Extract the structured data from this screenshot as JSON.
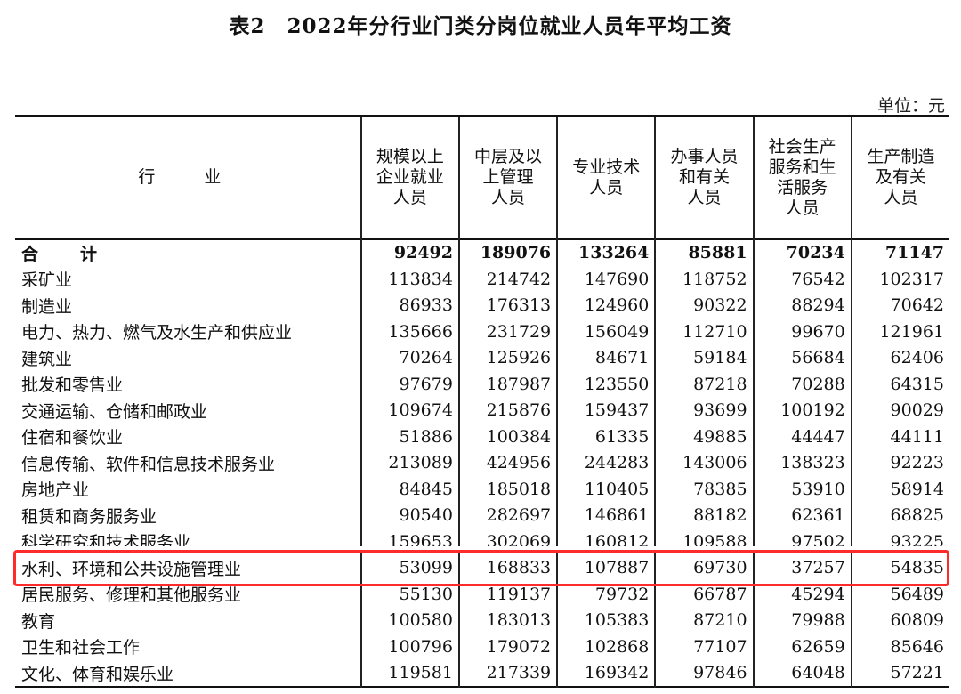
{
  "title": "表2　2022年分行业门类分岗位就业人员年平均工资",
  "unit": "单位：元",
  "headers": {
    "industry": "行　业",
    "cols": [
      [
        "规模以上",
        "企业就业",
        "人员"
      ],
      [
        "中层及以",
        "上管理",
        "人员"
      ],
      [
        "专业技术",
        "人员"
      ],
      [
        "办事人员",
        "和有关",
        "人员"
      ],
      [
        "社会生产",
        "服务和生",
        "活服务",
        "人员"
      ],
      [
        "生产制造",
        "及有关",
        "人员"
      ]
    ]
  },
  "rows": [
    {
      "name": "合　计",
      "values": [
        "92492",
        "189076",
        "133264",
        "85881",
        "70234",
        "71147"
      ],
      "total": true
    },
    {
      "name": "采矿业",
      "values": [
        "113834",
        "214742",
        "147690",
        "118752",
        "76542",
        "102317"
      ]
    },
    {
      "name": "制造业",
      "values": [
        "86933",
        "176313",
        "124960",
        "90322",
        "88294",
        "70642"
      ]
    },
    {
      "name": "电力、热力、燃气及水生产和供应业",
      "values": [
        "135666",
        "231729",
        "156049",
        "112710",
        "99670",
        "121961"
      ]
    },
    {
      "name": "建筑业",
      "values": [
        "70264",
        "125926",
        "84671",
        "59184",
        "56684",
        "62406"
      ]
    },
    {
      "name": "批发和零售业",
      "values": [
        "97679",
        "187987",
        "123550",
        "87218",
        "70288",
        "64315"
      ]
    },
    {
      "name": "交通运输、仓储和邮政业",
      "values": [
        "109674",
        "215876",
        "159437",
        "93699",
        "100192",
        "90029"
      ]
    },
    {
      "name": "住宿和餐饮业",
      "values": [
        "51886",
        "100384",
        "61335",
        "49885",
        "44447",
        "44111"
      ]
    },
    {
      "name": "信息传输、软件和信息技术服务业",
      "values": [
        "213089",
        "424956",
        "244283",
        "143006",
        "138323",
        "92223"
      ]
    },
    {
      "name": "房地产业",
      "values": [
        "84845",
        "185018",
        "110405",
        "78385",
        "53910",
        "58914"
      ]
    },
    {
      "name": "租赁和商务服务业",
      "values": [
        "90540",
        "282697",
        "146861",
        "88182",
        "62361",
        "68825"
      ]
    },
    {
      "name": "科学研究和技术服务业",
      "values": [
        "159653",
        "302069",
        "160812",
        "109588",
        "97502",
        "93225"
      ]
    },
    {
      "name": "水利、环境和公共设施管理业",
      "values": [
        "53099",
        "168833",
        "107887",
        "69730",
        "37257",
        "54835"
      ],
      "highlighted": true
    },
    {
      "name": "居民服务、修理和其他服务业",
      "values": [
        "55130",
        "119137",
        "79732",
        "66787",
        "45294",
        "56489"
      ]
    },
    {
      "name": "教育",
      "values": [
        "100580",
        "183013",
        "105383",
        "87210",
        "79988",
        "60809"
      ]
    },
    {
      "name": "卫生和社会工作",
      "values": [
        "100796",
        "179072",
        "102868",
        "77107",
        "62659",
        "85646"
      ]
    },
    {
      "name": "文化、体育和娱乐业",
      "values": [
        "119581",
        "217339",
        "169342",
        "97846",
        "64048",
        "57221"
      ]
    }
  ],
  "colors": {
    "highlight": "#ff2a2a"
  }
}
